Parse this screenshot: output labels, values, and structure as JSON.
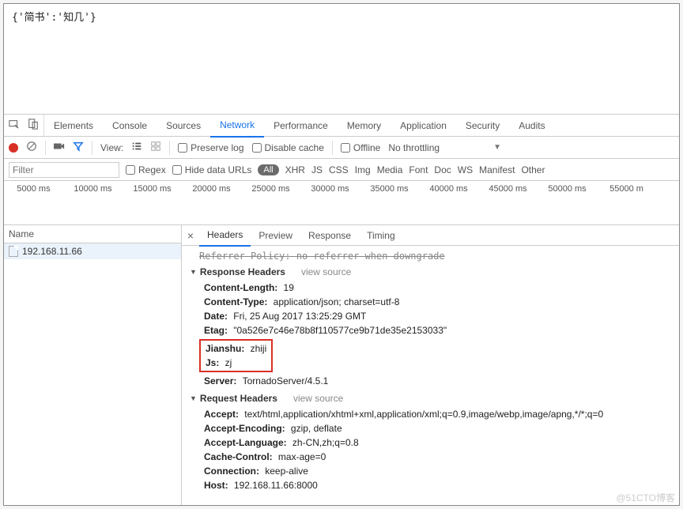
{
  "page_content": "{'简书':'知几'}",
  "tabs": {
    "elements": "Elements",
    "console": "Console",
    "sources": "Sources",
    "network": "Network",
    "performance": "Performance",
    "memory": "Memory",
    "application": "Application",
    "security": "Security",
    "audits": "Audits"
  },
  "toolbar": {
    "view": "View:",
    "preserve": "Preserve log",
    "disable": "Disable cache",
    "offline": "Offline",
    "throttle": "No throttling"
  },
  "filter": {
    "placeholder": "Filter",
    "regex": "Regex",
    "hide": "Hide data URLs",
    "all": "All",
    "types": {
      "xhr": "XHR",
      "js": "JS",
      "css": "CSS",
      "img": "Img",
      "media": "Media",
      "font": "Font",
      "doc": "Doc",
      "ws": "WS",
      "manifest": "Manifest",
      "other": "Other"
    }
  },
  "timeline": [
    "5000 ms",
    "10000 ms",
    "15000 ms",
    "20000 ms",
    "25000 ms",
    "30000 ms",
    "35000 ms",
    "40000 ms",
    "45000 ms",
    "50000 ms",
    "55000 m"
  ],
  "name_col": {
    "header": "Name",
    "item": "192.168.11.66"
  },
  "detail_tabs": {
    "headers": "Headers",
    "preview": "Preview",
    "response": "Response",
    "timing": "Timing"
  },
  "headers": {
    "truncated": "Referrer Policy: no-referrer-when-downgrade",
    "response_title": "Response Headers",
    "view_source": "view source",
    "resp": [
      {
        "k": "Content-Length:",
        "v": "19"
      },
      {
        "k": "Content-Type:",
        "v": "application/json; charset=utf-8"
      },
      {
        "k": "Date:",
        "v": "Fri, 25 Aug 2017 13:25:29 GMT"
      },
      {
        "k": "Etag:",
        "v": "\"0a526e7c46e78b8f110577ce9b71de35e2153033\""
      }
    ],
    "highlight": [
      {
        "k": "Jianshu:",
        "v": "zhiji"
      },
      {
        "k": "Js:",
        "v": "zj"
      }
    ],
    "server": {
      "k": "Server:",
      "v": "TornadoServer/4.5.1"
    },
    "request_title": "Request Headers",
    "req": [
      {
        "k": "Accept:",
        "v": "text/html,application/xhtml+xml,application/xml;q=0.9,image/webp,image/apng,*/*;q=0"
      },
      {
        "k": "Accept-Encoding:",
        "v": "gzip, deflate"
      },
      {
        "k": "Accept-Language:",
        "v": "zh-CN,zh;q=0.8"
      },
      {
        "k": "Cache-Control:",
        "v": "max-age=0"
      },
      {
        "k": "Connection:",
        "v": "keep-alive"
      },
      {
        "k": "Host:",
        "v": "192.168.11.66:8000"
      }
    ]
  },
  "watermark": "@51CTO博客"
}
